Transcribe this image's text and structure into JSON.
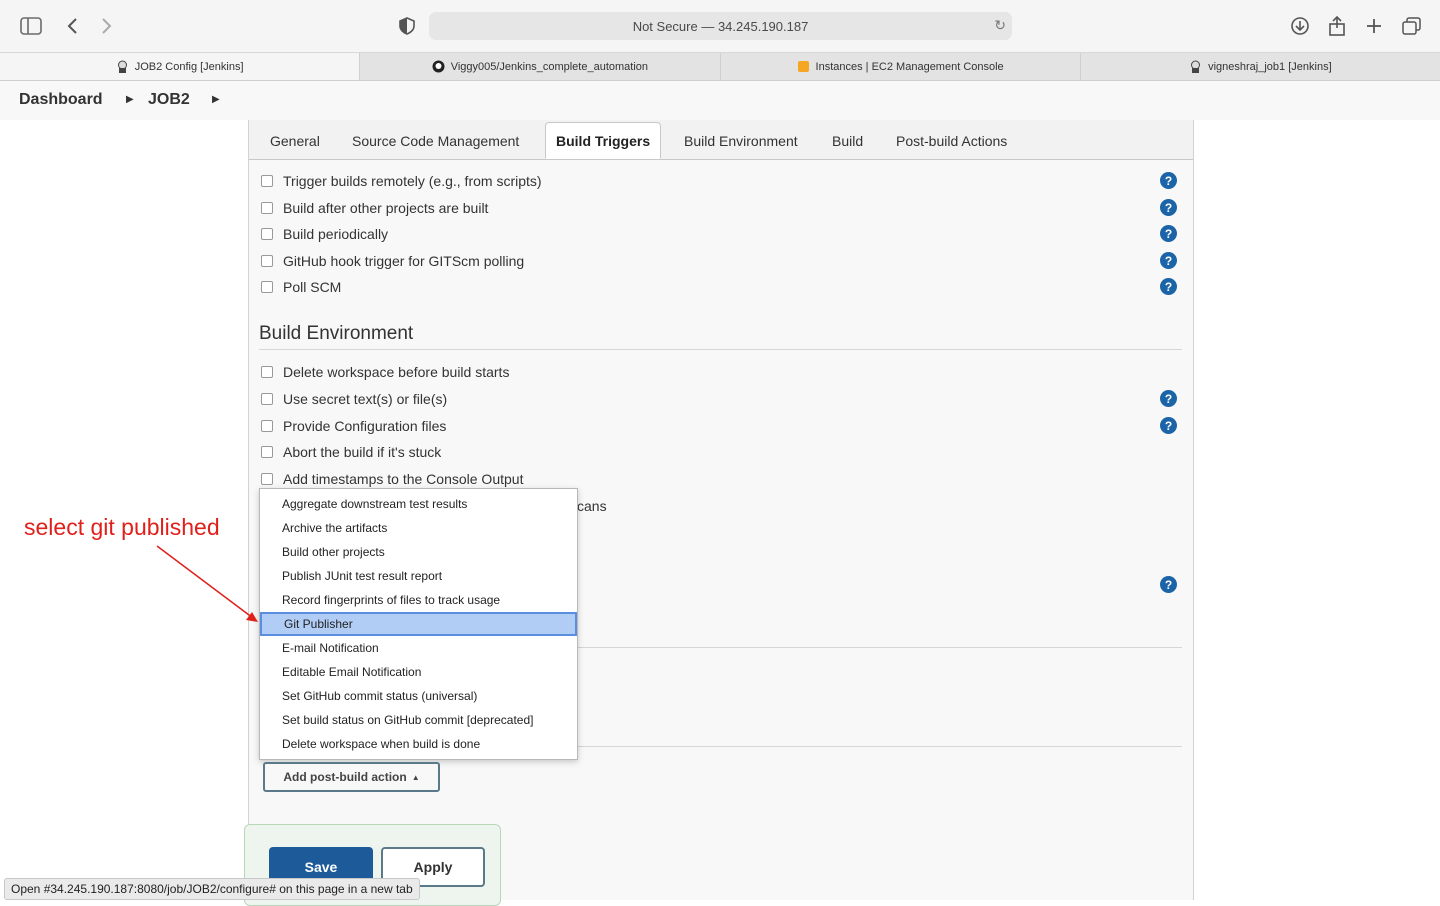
{
  "browser": {
    "url": "Not Secure — 34.245.190.187",
    "tabs": [
      {
        "label": "JOB2 Config [Jenkins]",
        "icon": "jenkins-icon"
      },
      {
        "label": "Viggy005/Jenkins_complete_automation",
        "icon": "github-icon"
      },
      {
        "label": "Instances | EC2 Management Console",
        "icon": "aws-icon"
      },
      {
        "label": "vigneshraj_job1 [Jenkins]",
        "icon": "jenkins-icon"
      }
    ]
  },
  "breadcrumb": {
    "dashboard": "Dashboard",
    "job": "JOB2"
  },
  "config_tabs": [
    "General",
    "Source Code Management",
    "Build Triggers",
    "Build Environment",
    "Build",
    "Post-build Actions"
  ],
  "active_tab": "Build Triggers",
  "build_triggers": [
    "Trigger builds remotely (e.g., from scripts)",
    "Build after other projects are built",
    "Build periodically",
    "GitHub hook trigger for GITScm polling",
    "Poll SCM"
  ],
  "build_environment": {
    "title": "Build Environment",
    "items": [
      "Delete workspace before build starts",
      "Use secret text(s) or file(s)",
      "Provide Configuration files",
      "Abort the build if it's stuck",
      "Add timestamps to the Console Output"
    ],
    "partial_text": "cans"
  },
  "menu_items": [
    "Aggregate downstream test results",
    "Archive the artifacts",
    "Build other projects",
    "Publish JUnit test result report",
    "Record fingerprints of files to track usage",
    "Git Publisher",
    "E-mail Notification",
    "Editable Email Notification",
    "Set GitHub commit status (universal)",
    "Set build status on GitHub commit [deprecated]",
    "Delete workspace when build is done"
  ],
  "selected_menu_item": "Git Publisher",
  "add_post_build_label": "Add post-build action",
  "save_label": "Save",
  "apply_label": "Apply",
  "status_bar": "Open #34.245.190.187:8080/job/JOB2/configure# on this page in a new tab",
  "annotation": "select git published",
  "colors": {
    "annotation": "#e0201a",
    "save_button": "#1d5a9a",
    "selection": "#b1cdf5",
    "help": "#1c64a8"
  }
}
